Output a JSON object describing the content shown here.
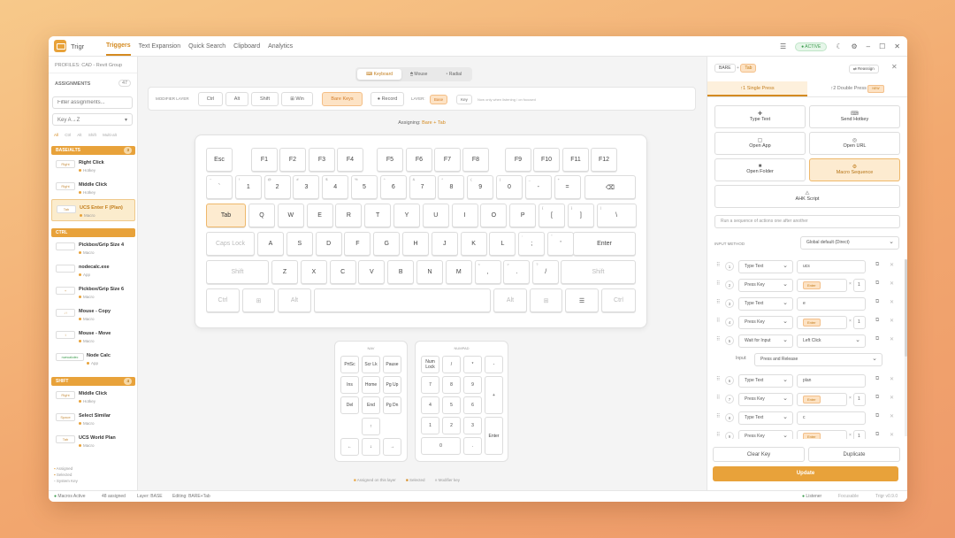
{
  "app": {
    "name": "Trigr",
    "tabs": [
      "Triggers",
      "Text Expansion",
      "Quick Search",
      "Clipboard",
      "Analytics"
    ],
    "active_tab": "Triggers",
    "status_pill": "ACTIVE"
  },
  "sidebar": {
    "profile": "PROFILES: CAD - Revit Group",
    "assignments_label": "ASSIGNMENTS",
    "assignments_count": "47",
    "filter_placeholder": "Filter assignments...",
    "sort_value": "Key A→Z",
    "filter_chips": [
      "All",
      "Ctrl",
      "Alt",
      "Shift",
      "Multi-alt"
    ],
    "groups": [
      {
        "name": "BASE/ALTS",
        "count": "3",
        "items": [
          {
            "key": "Right",
            "name": "Right Click",
            "type": "Hotkey"
          },
          {
            "key": "Right",
            "name": "Middle Click",
            "type": "Hotkey"
          },
          {
            "key": "Tab",
            "name": "UCS Enter F (Plan)",
            "type": "Macro"
          }
        ]
      },
      {
        "name": "CTRL",
        "count": "",
        "items": [
          {
            "key": "",
            "name": "Pickbox/Grip Size 4",
            "type": "Macro"
          },
          {
            "key": "",
            "name": "nodecalc.exe",
            "type": "App"
          },
          {
            "key": "+",
            "name": "Pickbox/Grip Size 6",
            "type": "Macro"
          },
          {
            "key": "↓↑",
            "name": "Mouse - Copy",
            "type": "Macro"
          },
          {
            "key": "↕",
            "name": "Mouse - Move",
            "type": "Macro"
          },
          {
            "key": "numcalcdec",
            "name": "Node Calc",
            "type": "App"
          }
        ]
      },
      {
        "name": "SHIFT",
        "count": "4",
        "items": [
          {
            "key": "Right",
            "name": "Middle Click",
            "type": "Hotkey"
          },
          {
            "key": "Space",
            "name": "Select Similar",
            "type": "Macro"
          },
          {
            "key": "Tab",
            "name": "UCS World Plan",
            "type": "Macro"
          }
        ]
      }
    ],
    "legend": [
      "Assigned",
      "Selected",
      "System Key"
    ]
  },
  "center": {
    "view_tabs": [
      "Keyboard",
      "Mouse",
      "Radial"
    ],
    "active_view": "Keyboard",
    "modifier_label": "MODIFIER LAYER",
    "modifiers": [
      "Ctrl",
      "Alt",
      "Shift",
      "Win"
    ],
    "bare_keys": "Bare Keys",
    "record": "Record",
    "layer_label": "LAYER:",
    "layer_value": "Base",
    "layer_key": "Key",
    "layer_note": "Now only when listening / on focused",
    "assigning_prefix": "Assigning:",
    "assigning_value": "Bare + Tab",
    "nav_title": "NAV",
    "numpad_title": "NUMPAD",
    "legend": [
      "Assigned on this layer",
      "Selected",
      "Modifier key"
    ]
  },
  "keyboard": {
    "row0": [
      "Esc",
      "F1",
      "F2",
      "F3",
      "F4",
      "F5",
      "F6",
      "F7",
      "F8",
      "F9",
      "F10",
      "F11",
      "F12"
    ],
    "row1": [
      "`",
      "1",
      "2",
      "3",
      "4",
      "5",
      "6",
      "7",
      "8",
      "9",
      "0",
      "-",
      "=",
      "⌫"
    ],
    "row1_shift": [
      "~",
      "!",
      "@",
      "#",
      "$",
      "%",
      "^",
      "&",
      "*",
      "(",
      ")",
      "_",
      "+",
      ""
    ],
    "row2": [
      "Tab",
      "Q",
      "W",
      "E",
      "R",
      "T",
      "Y",
      "U",
      "I",
      "O",
      "P",
      "[",
      "]",
      "\\"
    ],
    "row2_shift": [
      "",
      "",
      "",
      "",
      "",
      "",
      "",
      "",
      "",
      "",
      "",
      "{",
      "}",
      "|"
    ],
    "row3": [
      "Caps Lock",
      "A",
      "S",
      "D",
      "F",
      "G",
      "H",
      "J",
      "K",
      "L",
      ";",
      "'",
      "Enter"
    ],
    "row3_shift": [
      "",
      "",
      "",
      "",
      "",
      "",
      "",
      "",
      "",
      "",
      ":",
      "\"",
      ""
    ],
    "row4": [
      "Shift",
      "Z",
      "X",
      "C",
      "V",
      "B",
      "N",
      "M",
      ",",
      ".",
      "/",
      "Shift"
    ],
    "row4_shift": [
      "",
      "",
      "",
      "",
      "",
      "",
      "",
      "",
      "<",
      ">",
      "?",
      ""
    ],
    "row5": [
      "Ctrl",
      "⊞",
      "Alt",
      "",
      "Alt",
      "⊞",
      "☰",
      "Ctrl"
    ],
    "nav": [
      "PrtSc",
      "Scr Lk",
      "Pause",
      "Ins",
      "Home",
      "Pg Up",
      "Del",
      "End",
      "Pg Dn",
      "↑",
      "←",
      "↓",
      "→"
    ],
    "numpad": [
      "Num Lock",
      "/",
      "*",
      "-",
      "7",
      "8",
      "9",
      "+",
      "4",
      "5",
      "6",
      "1",
      "2",
      "3",
      "Enter",
      "0",
      "."
    ]
  },
  "panel": {
    "layer_badge": "BARE",
    "key_badge": "Tab",
    "reassign": "Reassign",
    "tabs": [
      "Single Press",
      "Double Press"
    ],
    "double_badge": "NEW",
    "actions": [
      "Type Text",
      "Send Hotkey",
      "Open App",
      "Open URL",
      "Open Folder",
      "Macro Sequence",
      "AHK Script"
    ],
    "active_action": "Macro Sequence",
    "description": "Run a sequence of actions one after another",
    "input_method_label": "INPUT METHOD",
    "input_method_value": "Global default (Direct)",
    "steps": [
      {
        "n": "1",
        "type": "Type Text",
        "value": "ucs"
      },
      {
        "n": "2",
        "type": "Press Key",
        "value": "Enter",
        "repeat": "1"
      },
      {
        "n": "3",
        "type": "Type Text",
        "value": "e"
      },
      {
        "n": "4",
        "type": "Press Key",
        "value": "Enter",
        "repeat": "1"
      },
      {
        "n": "5",
        "type": "Wait for Input",
        "value": "Left Click",
        "sub_label": "Input:",
        "sub_value": "Press and Release"
      },
      {
        "n": "6",
        "type": "Type Text",
        "value": "plan"
      },
      {
        "n": "7",
        "type": "Press Key",
        "value": "Enter",
        "repeat": "1"
      },
      {
        "n": "8",
        "type": "Type Text",
        "value": "c"
      },
      {
        "n": "9",
        "type": "Press Key",
        "value": "Enter",
        "repeat": "1"
      }
    ],
    "clear_key": "Clear Key",
    "duplicate": "Duplicate",
    "update": "Update"
  },
  "status": {
    "macros": "Macros Active",
    "assigned": "48 assigned",
    "layer": "Layer: BASE",
    "editing": "Editing: BARE+Tab",
    "listener": "Listener",
    "focusable": "Focusable",
    "version": "Trigr v0.9.0"
  }
}
